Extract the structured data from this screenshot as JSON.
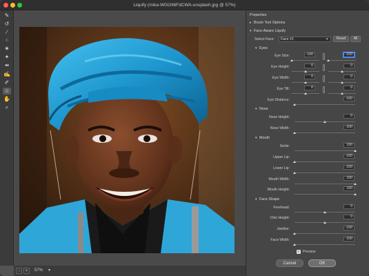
{
  "window": {
    "title": "Liquify (mika-W0i1N6FdCWA-unsplash.jpg @ 57%)"
  },
  "toolbar": {
    "tools": [
      {
        "name": "forward-warp-tool-icon",
        "glyph": "✎"
      },
      {
        "name": "reconstruct-tool-icon",
        "glyph": "↺"
      },
      {
        "name": "smooth-tool-icon",
        "glyph": "∕"
      },
      {
        "name": "twirl-clockwise-tool-icon",
        "glyph": "⁘"
      },
      {
        "name": "pucker-tool-icon",
        "glyph": "✷"
      },
      {
        "name": "bloat-tool-icon",
        "glyph": "✦"
      },
      {
        "name": "push-left-tool-icon",
        "glyph": "⇴"
      },
      {
        "name": "freeze-mask-tool-icon",
        "glyph": "✍"
      },
      {
        "name": "thaw-mask-tool-icon",
        "glyph": "✐"
      },
      {
        "name": "face-tool-icon",
        "glyph": "☺"
      },
      {
        "name": "hand-tool-icon",
        "glyph": "✋"
      },
      {
        "name": "zoom-tool-icon",
        "glyph": "⌕"
      }
    ]
  },
  "bottom_bar": {
    "zoom_value": "57%",
    "zoom_out_glyph": "−",
    "zoom_in_glyph": "+",
    "dropdown_glyph": "▾"
  },
  "properties": {
    "header": "Properties",
    "brush_tool_options": "Brush Tool Options",
    "face_aware_liquify": "Face-Aware Liquify",
    "select_face_label": "Select Face:",
    "select_face_value": "Face #1",
    "reset_label": "Reset",
    "all_label": "All",
    "expanded_glyph": "▾",
    "collapsed_glyph": "▸",
    "eyes": {
      "title": "Eyes",
      "eye_size": {
        "label": "Eye Size:",
        "left": "-100",
        "right": "-100",
        "left_level": 0.0,
        "right_level": 0.0
      },
      "eye_height": {
        "label": "Eye Height:",
        "left": "0",
        "right": "0",
        "left_level": 0.5,
        "right_level": 0.5
      },
      "eye_width": {
        "label": "Eye Width:",
        "left": "0",
        "right": "0",
        "left_level": 0.5,
        "right_level": 0.5
      },
      "eye_tilt": {
        "label": "Eye Tilt:",
        "left": "0",
        "right": "0",
        "left_level": 0.5,
        "right_level": 0.5
      },
      "eye_distance": {
        "label": "Eye Distance:",
        "value": "-100",
        "level": 0.0
      }
    },
    "nose": {
      "title": "Nose",
      "nose_height": {
        "label": "Nose Height:",
        "value": "0",
        "level": 0.5
      },
      "nose_width": {
        "label": "Nose Width:",
        "value": "-100",
        "level": 0.0
      }
    },
    "mouth": {
      "title": "Mouth",
      "smile": {
        "label": "Smile:",
        "value": "100",
        "level": 1.0
      },
      "upper_lip": {
        "label": "Upper Lip:",
        "value": "-100",
        "level": 0.0
      },
      "lower_lip": {
        "label": "Lower Lip:",
        "value": "-100",
        "level": 0.0
      },
      "mouth_width": {
        "label": "Mouth Width:",
        "value": "100",
        "level": 1.0
      },
      "mouth_height": {
        "label": "Mouth Height:",
        "value": "100",
        "level": 1.0
      }
    },
    "face_shape": {
      "title": "Face Shape",
      "forehead": {
        "label": "Forehead:",
        "value": "0",
        "level": 0.5
      },
      "chin_height": {
        "label": "Chin Height:",
        "value": "0",
        "level": 0.5
      },
      "jawline": {
        "label": "Jawline:",
        "value": "-100",
        "level": 0.0
      },
      "face_width": {
        "label": "Face Width:",
        "value": "-100",
        "level": 0.0
      }
    },
    "preview_label": "Preview",
    "preview_checked": true,
    "check_glyph": "✓",
    "cancel_label": "Cancel",
    "ok_label": "OK"
  },
  "colors": {
    "turban": "#1f9bd1",
    "shirt": "#2fa6d8",
    "skin": "#6b3a22",
    "background_dark": "#3a2415",
    "highlight": "#4b8bf5"
  }
}
